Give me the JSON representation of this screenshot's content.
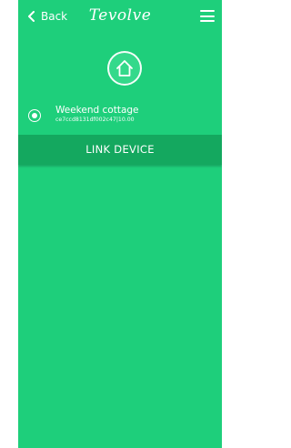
{
  "header": {
    "back_label": "Back",
    "brand": "Tevolve"
  },
  "device": {
    "name": "Weekend cottage",
    "details": "ce7ccd8131df002c47|10.00",
    "selected": true
  },
  "actions": {
    "link_device_label": "LINK DEVICE"
  },
  "theme": {
    "background": "#1ecf7b",
    "button": "#14a85f",
    "foreground": "#ffffff"
  }
}
